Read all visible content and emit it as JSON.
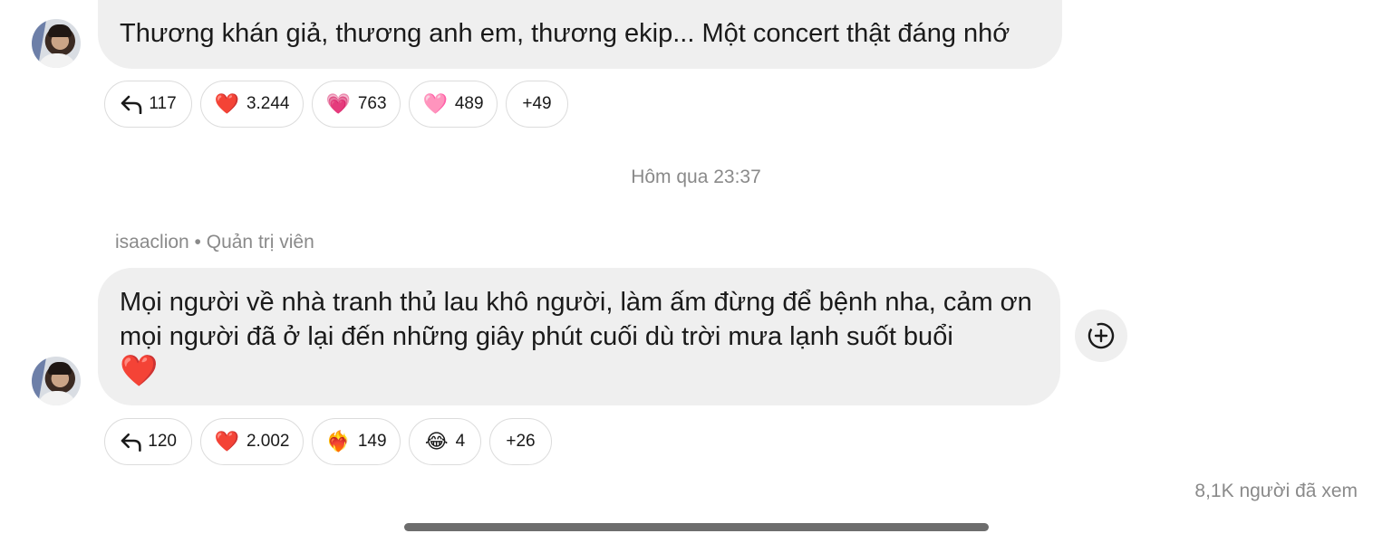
{
  "messages": [
    {
      "text": "Thương khán giả, thương anh em, thương ekip... Một concert thật đáng nhớ",
      "reactions": [
        {
          "icon": "reply-icon",
          "emoji": "",
          "count": "117"
        },
        {
          "icon": "red-heart-icon",
          "emoji": "❤️",
          "count": "3.244"
        },
        {
          "icon": "growing-heart-icon",
          "emoji": "💗",
          "count": "763"
        },
        {
          "icon": "pink-heart-icon",
          "emoji": "🩷",
          "count": "489"
        },
        {
          "icon": "",
          "emoji": "",
          "count": "+49"
        }
      ]
    },
    {
      "sender": "isaaclion • Quản trị viên",
      "text": "Mọi người về nhà tranh thủ lau khô người, làm ấm đừng để bệnh nha, cảm ơn mọi người đã ở lại đến những giây phút cuối dù trời mưa lạnh suốt buổi",
      "text_emoji": "❤️",
      "reactions": [
        {
          "icon": "reply-icon",
          "emoji": "",
          "count": "120"
        },
        {
          "icon": "red-heart-icon",
          "emoji": "❤️",
          "count": "2.002"
        },
        {
          "icon": "heart-on-fire-icon",
          "emoji": "❤️‍🔥",
          "count": "149"
        },
        {
          "icon": "tears-of-joy-icon",
          "emoji": "😂",
          "count": "4"
        },
        {
          "icon": "",
          "emoji": "",
          "count": "+26"
        }
      ]
    }
  ],
  "timestamp": "Hôm qua 23:37",
  "views": "8,1K người đã xem",
  "colors": {
    "bubble": "#efefef",
    "muted_text": "#8a8a8a",
    "heart": "#e3242b"
  }
}
